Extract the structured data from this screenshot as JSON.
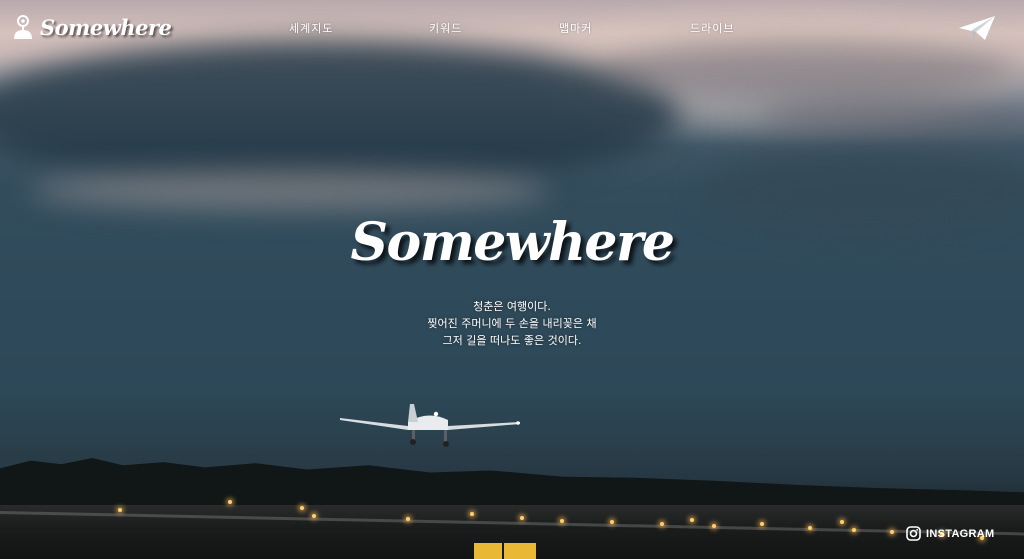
{
  "brand": {
    "logo_text": "Somewhere",
    "logo_icon": "map-pin-person-icon"
  },
  "nav": {
    "items": [
      {
        "label": "세계지도"
      },
      {
        "label": "키워드"
      },
      {
        "label": "맵마커"
      },
      {
        "label": "드라이브"
      }
    ],
    "send_icon": "paper-plane-icon"
  },
  "hero": {
    "title": "Somewhere",
    "tagline": [
      "청춘은 여행이다.",
      "찢어진 주머니에 두 손을 내리꽂은 채",
      "그저 길을 떠나도 좋은 것이다."
    ]
  },
  "footer": {
    "instagram_label": "INSTAGRAM",
    "instagram_icon": "instagram-icon"
  },
  "runway_signs": [
    "",
    ""
  ],
  "colors": {
    "text": "#ffffff",
    "sign": "#e9b935"
  }
}
